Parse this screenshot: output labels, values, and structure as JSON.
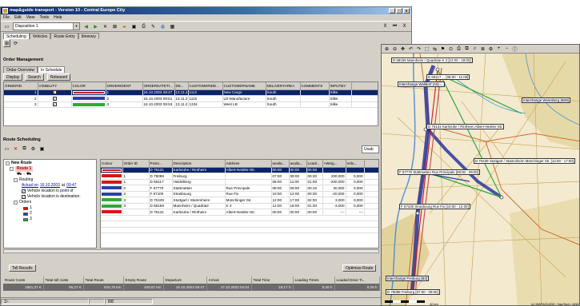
{
  "window": {
    "title": "map&guide transport - Version 10 - Central Europe City",
    "controls": [
      "_",
      "□",
      "x"
    ]
  },
  "menu": [
    "File",
    "Edit",
    "View",
    "Tools",
    "Help"
  ],
  "toolbar": {
    "combo_value": "Disposition 1",
    "nav_right": [
      "X",
      "⏮",
      "X"
    ]
  },
  "main_tabs": [
    "Scheduling",
    "Vehicles",
    "Route Entry",
    "Itinerary"
  ],
  "order_management": {
    "heading": "Order Management",
    "subtabs": [
      "Order Overview",
      "In Schedule"
    ],
    "buttons": [
      "Display",
      "Search",
      "Released"
    ],
    "columns": [
      "ORDERID",
      "VISIBILITY",
      "COLOR",
      "ORDERIDENT",
      "ORDERDATETI...",
      "DE...",
      "CUSTOMERIDE...",
      "CUSTOMERNAME",
      "DELIVERYAREA",
      "COMMENTS",
      "INPUTBY"
    ],
    "rows": [
      {
        "id": "1",
        "visible": "✓",
        "color": "#d01818",
        "ident": "1",
        "datetime": "16.10.2003 09:47",
        "de": "13.11.2",
        "custid": "1112",
        "custname": "New Cargo",
        "area": "South",
        "comments": "",
        "input": "Silke",
        "selected": true
      },
      {
        "id": "2",
        "visible": "✓",
        "color": "#2a3fa8",
        "ident": "2",
        "datetime": "16.10.2003 09:51",
        "de": "13.11.2",
        "custid": "1115",
        "custname": "LD-Manufacture",
        "area": "South",
        "comments": "",
        "input": "Silke",
        "selected": false
      },
      {
        "id": "3",
        "visible": "✓",
        "color": "#2fa83a",
        "ident": "3",
        "datetime": "16.10.2003 09:53",
        "de": "13.11.2",
        "custid": "1334",
        "custname": "West LB",
        "area": "South",
        "comments": "",
        "input": "Silke",
        "selected": false
      }
    ]
  },
  "route_scheduling": {
    "heading": "Route Scheduling",
    "right_combo": "Usab",
    "tree": {
      "root": "New Route",
      "route": "Route 1",
      "routing_label": "Routing",
      "actual_prefix": "Actual on",
      "actual_date": "16.10.2003",
      "actual_at": "at",
      "actual_time": "09:47",
      "check1": "Vehicle location is point of",
      "check2": "Vehicle location is destination.",
      "orders_label": "Orders",
      "orders": [
        "1",
        "2",
        "3"
      ]
    },
    "columns": [
      "Colour",
      "Order ID",
      "Postc...",
      "Description",
      "Address",
      "availa...",
      "availa...",
      "Loadi...",
      "+Weig...",
      "Volu..."
    ],
    "rows": [
      {
        "color": "#d01818",
        "order": "",
        "postcode": "D 76131",
        "desc": "Karlsruhe / Rintheim",
        "addr": "Albert-Nestler-Str.",
        "a1": "00:00",
        "a2": "00:00",
        "load": "00:00",
        "weight": "",
        "vol": "",
        "selected": true
      },
      {
        "color": "#d01818",
        "order": "1",
        "postcode": "D 79098",
        "desc": "Freiburg",
        "addr": "",
        "a1": "07:00",
        "a2": "09:00",
        "load": "00:30",
        "weight": "200,000",
        "vol": "0,000",
        "selected": false
      },
      {
        "color": "#d01818",
        "order": "1",
        "postcode": "D 69117",
        "desc": "Heidelberg",
        "addr": "",
        "a1": "08:00",
        "a2": "11:00",
        "load": "01:00",
        "weight": "-200,000",
        "vol": "0,000",
        "selected": false
      },
      {
        "color": "#2a3fa8",
        "order": "2",
        "postcode": "F 67770",
        "desc": "Stattmatten",
        "addr": "Rue Principale",
        "a1": "08:00",
        "a2": "09:00",
        "load": "00:15",
        "weight": "20,000",
        "vol": "0,000",
        "selected": false
      },
      {
        "color": "#2a3fa8",
        "order": "2",
        "postcode": "F 67100",
        "desc": "Strasbourg",
        "addr": "Rue Fix",
        "a1": "10:00",
        "a2": "12:00",
        "load": "00:30",
        "weight": "-20,000",
        "vol": "0,000",
        "selected": false
      },
      {
        "color": "#2fa83a",
        "order": "3",
        "postcode": "D 70439",
        "desc": "Stuttgart / Stammheim",
        "addr": "Münchinger Str.",
        "a1": "12:00",
        "a2": "17:00",
        "load": "02:00",
        "weight": "3,000",
        "vol": "0,000",
        "selected": false
      },
      {
        "color": "#2fa83a",
        "order": "3",
        "postcode": "D 68159",
        "desc": "Mannheim / Quadrate",
        "addr": "K 3",
        "a1": "12:00",
        "a2": "18:00",
        "load": "01:30",
        "weight": "-3,000",
        "vol": "0,000",
        "selected": false
      },
      {
        "color": "#d01818",
        "order": "",
        "postcode": "D 76131",
        "desc": "Karlsruhe / Rintheim",
        "addr": "Albert-Nestler-Str.",
        "a1": "00:00",
        "a2": "00:00",
        "load": "00:00",
        "weight": "---",
        "vol": "---",
        "selected": false
      }
    ],
    "toll_button": "Toll Results",
    "optimize_button": "Optimize Route"
  },
  "stats": {
    "headers": [
      "Route Costs",
      "Total toll costs",
      "Total Route",
      "Empty Route",
      "Departure",
      "Arrival",
      "Total Time",
      "Loading Times",
      "Loaded Drive Ti..."
    ],
    "values": [
      "1851,37 €",
      "95,27 €",
      "915,75 km",
      "459,67 km",
      "16.10.2003 09:47",
      "17.10.2003 04:04",
      "18:17 h",
      "5:45 h",
      "6:39 h"
    ]
  },
  "statusbar": [
    "1/-",
    "",
    "8/8"
  ],
  "map": {
    "toolbar_icons": [
      "zoom-in",
      "zoom-out",
      "pan",
      "undo",
      "redo",
      "select",
      "route",
      "flag",
      "binoculars",
      "print",
      "copy",
      "find",
      "layers",
      "settings",
      "plus",
      "minus",
      "info"
    ],
    "labels": [
      "D 68159 Mannheim / Quadrate K 3 [12:00 - 18:00]",
      "D 69117 ... [08:00 - 11:00]",
      "Interchange Walldorf (A5) ...",
      "Interchange Weinsberg (B39)",
      "D 76131 Karlsruhe / Rintheim Albert-Nestler-Str.",
      "F 67770 Stattmatten Rue Principale [08:00 - 09:00]",
      "D 70439 Stuttgart / Stammheim Münchinger Str. [12:00 - 17:00]",
      "F 67100 Strasbourg Rue Fix [10:00 - 12:00]",
      "Interchange Freiburg (B3)",
      "D 79098 Freiburg [07:00 - 09:00]"
    ],
    "scale": "40 km",
    "copyright": "(c) MAP&GUIDE / NavTech / AND"
  }
}
